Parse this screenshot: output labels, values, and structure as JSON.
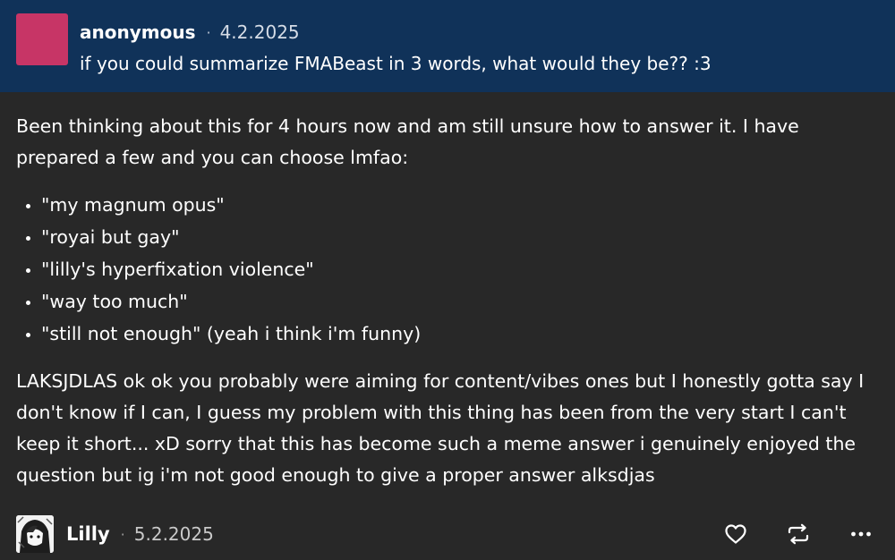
{
  "ask": {
    "asker": "anonymous",
    "separator": "·",
    "date": "4.2.2025",
    "question": "if you could summarize FMABeast in 3 words, what would they be?? :3",
    "avatar_color": "#c73566"
  },
  "answer": {
    "intro": "Been thinking about this for 4 hours now and am still unsure how to answer it. I have prepared a few and you can choose lmfao:",
    "options": [
      "\"my magnum opus\"",
      "\"royai but gay\"",
      "\"lilly's hyperfixation violence\"",
      "\"way too much\"",
      "\"still not enough\" (yeah i think i'm funny)"
    ],
    "closing": "LAKSJDLAS ok ok you probably were aiming for content/vibes ones but I honestly gotta say I don't know if I can, I guess my problem with this thing has been from the very start I can't keep it short... xD sorry that this has become such a meme answer i genuinely enjoyed the question but ig i'm not good enough to give a proper answer alksdjas"
  },
  "reply": {
    "author": "Lilly",
    "separator": "·",
    "date": "5.2.2025"
  },
  "actions": [
    {
      "icon": "heart-icon"
    },
    {
      "icon": "reblog-icon"
    },
    {
      "icon": "more-icon"
    }
  ],
  "colors": {
    "ask_background": "#103259",
    "body_background": "#282828"
  }
}
